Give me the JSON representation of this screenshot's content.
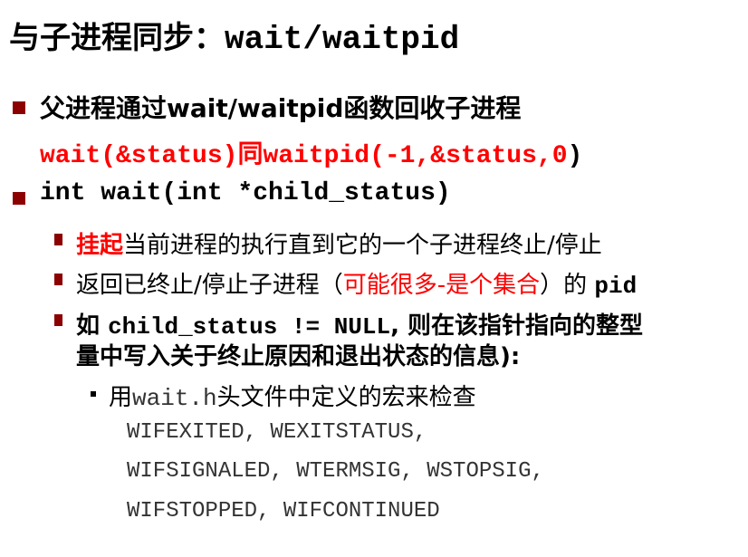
{
  "title": {
    "cn": "与子进程同步：",
    "code": "wait/waitpid"
  },
  "bullets": {
    "b1": "父进程通过wait/waitpid函数回收子进程",
    "b1_red1": "wait(&status)",
    "b1_red2": "同",
    "b1_red3": "waitpid(-1,&status,0",
    "b1_end": ")",
    "b2": "int wait(int *child_status)",
    "s1_red": "挂起",
    "s1": "当前进程的执行直到它的一个子进程终止/停止",
    "s2a": "返回已终止/停止子进程（",
    "s2_red": "可能很多-是个集合",
    "s2b": "）的 ",
    "s2_code": "pid",
    "s3a": "如 ",
    "s3_code": "child_status != NULL",
    "s3b": ", 则在该指针指向的整型",
    "s3c": "量中写入关于终止原因和退出状态的信息):",
    "t1a": "用",
    "t1_code": "wait.h",
    "t1b": "头文件中定义的宏来检查",
    "macros": [
      "WIFEXITED, WEXITSTATUS,",
      "WIFSIGNALED, WTERMSIG, WSTOPSIG,",
      "WIFSTOPPED, WIFCONTINUED"
    ]
  }
}
